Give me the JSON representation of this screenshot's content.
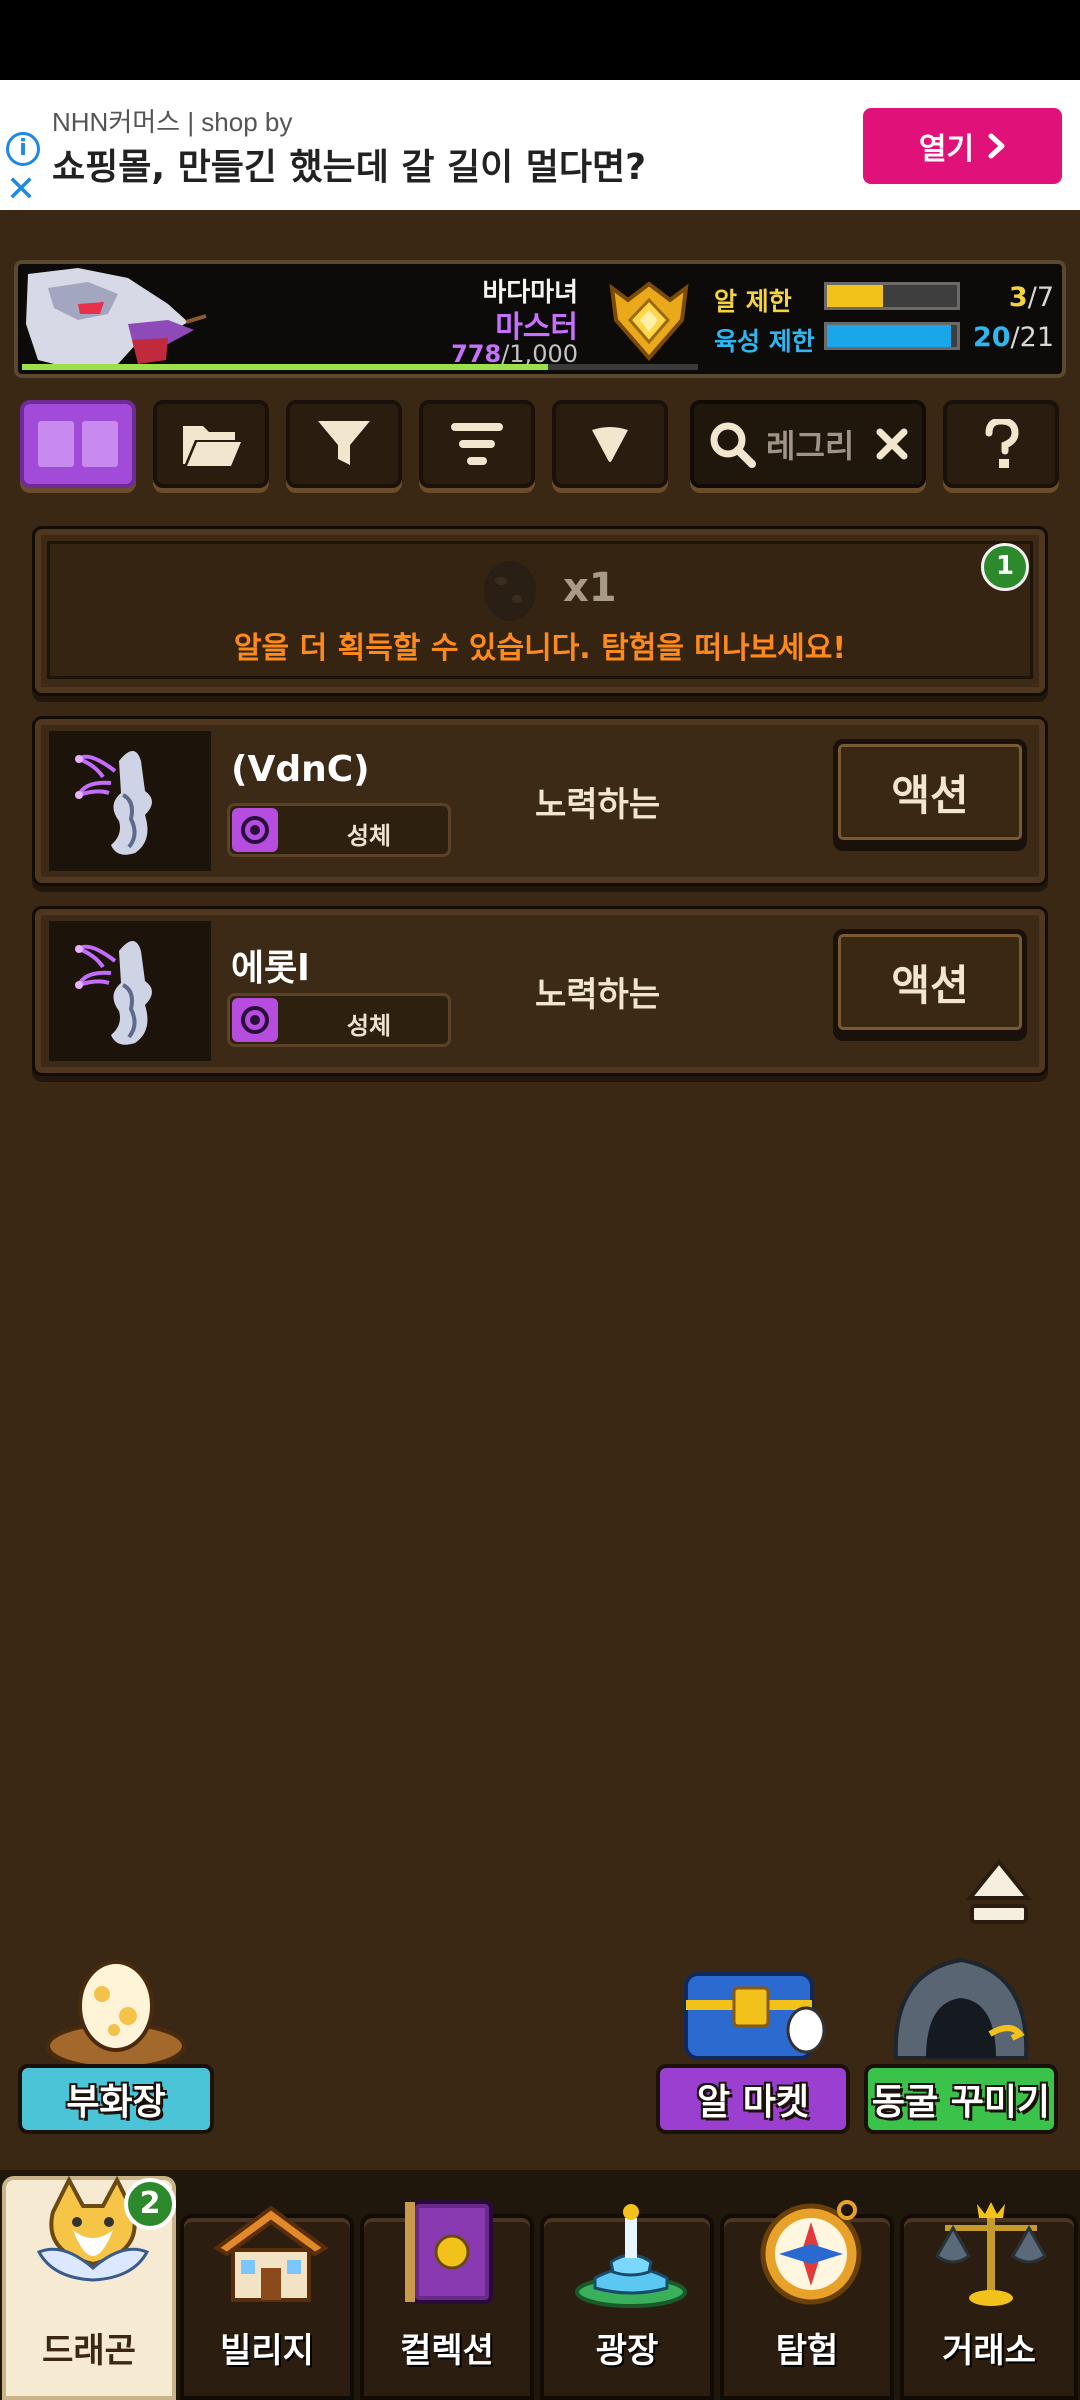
{
  "ad": {
    "sponsor": "NHN커머스 | shop by",
    "headline": "쇼핑몰, 만들긴 했는데 갈 길이 멀다면?",
    "open_label": "열기",
    "info_icon": "info-icon",
    "close_icon": "close-icon"
  },
  "profile": {
    "name": "바다마녀",
    "rank": "마스터",
    "xp_current": "778",
    "xp_max": "/1,000",
    "xp_fraction": 0.778,
    "egg_limit_label": "알 제한",
    "egg_limit_current": "3",
    "egg_limit_max": "/7",
    "egg_limit_fraction": 0.43,
    "raise_limit_label": "육성 제한",
    "raise_limit_current": "20",
    "raise_limit_max": "/21",
    "raise_limit_fraction": 0.95
  },
  "toolbar": {
    "search_text": "레그리",
    "icons": [
      "grid-view-icon",
      "folder-icon",
      "filter-icon",
      "sort-icon",
      "dropdown-icon",
      "search-icon",
      "clear-icon",
      "help-icon"
    ]
  },
  "egg_card": {
    "count": "x1",
    "message": "알을 더 획득할 수 있습니다. 탐험을 떠나보세요!",
    "badge": "1"
  },
  "dragons": [
    {
      "name": "(VdnC)",
      "element": "성체",
      "status": "노력하는",
      "action": "액션"
    },
    {
      "name": "에롯l",
      "element": "성체",
      "status": "노력하는",
      "action": "액션"
    }
  ],
  "shortcuts": {
    "hatchery": "부화장",
    "egg_market": "알 마켓",
    "cave_decor": "동굴 꾸미기"
  },
  "nav": {
    "items": [
      {
        "label": "드래곤",
        "badge": "2"
      },
      {
        "label": "빌리지"
      },
      {
        "label": "컬렉션"
      },
      {
        "label": "광장"
      },
      {
        "label": "탐험"
      },
      {
        "label": "거래소"
      }
    ]
  },
  "colors": {
    "background": "#3a2814",
    "accent_purple": "#a24bd8",
    "orange_text": "#ff8a1c",
    "egg_limit_bar": "#f2c21a",
    "raise_limit_bar": "#1aa6e8",
    "badge_green": "#2c8a2c"
  }
}
